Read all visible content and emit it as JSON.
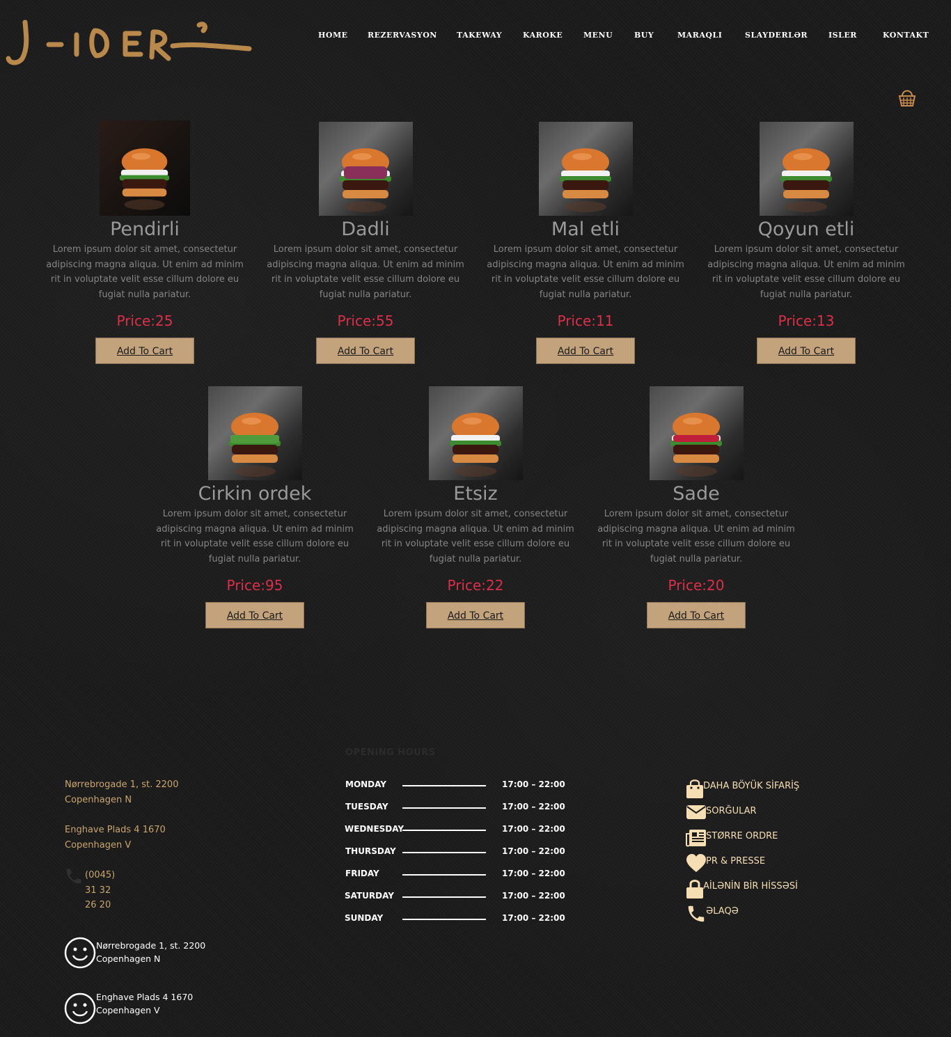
{
  "brand": {
    "logo_text": "SLIDER"
  },
  "nav": [
    "HOME",
    "REZERVASYON",
    "TAKEWAY",
    "KAROKE",
    "MENU",
    "BUY",
    "MARAQLI",
    "SLAYDERLƏR",
    "ISLER",
    "KONTAKT"
  ],
  "products": [
    {
      "name": "Pendirli",
      "desc": "Lorem ipsum dolor sit amet, consectetur adipiscing magna aliqua. Ut enim ad minim rit in voluptate velit esse cillum dolore eu fugiat nulla pariatur.",
      "price": "Price:25",
      "button": "Add To Cart"
    },
    {
      "name": "Dadli",
      "desc": "Lorem ipsum dolor sit amet, consectetur adipiscing magna aliqua. Ut enim ad minim rit in voluptate velit esse cillum dolore eu fugiat nulla pariatur.",
      "price": "Price:55",
      "button": "Add To Cart"
    },
    {
      "name": "Mal etli",
      "desc": "Lorem ipsum dolor sit amet, consectetur adipiscing magna aliqua. Ut enim ad minim rit in voluptate velit esse cillum dolore eu fugiat nulla pariatur.",
      "price": "Price:11",
      "button": "Add To Cart"
    },
    {
      "name": "Qoyun etli",
      "desc": "Lorem ipsum dolor sit amet, consectetur adipiscing magna aliqua. Ut enim ad minim rit in voluptate velit esse cillum dolore eu fugiat nulla pariatur.",
      "price": "Price:13",
      "button": "Add To Cart"
    },
    {
      "name": "Cirkin ordek",
      "desc": "Lorem ipsum dolor sit amet, consectetur adipiscing magna aliqua. Ut enim ad minim rit in voluptate velit esse cillum dolore eu fugiat nulla pariatur.",
      "price": "Price:95",
      "button": "Add To Cart"
    },
    {
      "name": "Etsiz",
      "desc": "Lorem ipsum dolor sit amet, consectetur adipiscing magna aliqua. Ut enim ad minim rit in voluptate velit esse cillum dolore eu fugiat nulla pariatur.",
      "price": "Price:22",
      "button": "Add To Cart"
    },
    {
      "name": "Sade",
      "desc": "Lorem ipsum dolor sit amet, consectetur adipiscing magna aliqua. Ut enim ad minim rit in voluptate velit esse cillum dolore eu fugiat nulla pariatur.",
      "price": "Price:20",
      "button": "Add To Cart"
    }
  ],
  "footer": {
    "address1": {
      "line1": "Nørrebrogade 1, st. 2200",
      "line2": "Copenhagen N"
    },
    "address2": {
      "line1": "Enghave Plads 4 1670",
      "line2": "Copenhagen V"
    },
    "phone": "(0045) 31 32 26 20",
    "hours_title": "OPENING HOURS",
    "hours": [
      {
        "day": "MONDAY",
        "time": "17:00 – 22:00"
      },
      {
        "day": "TUESDAY",
        "time": "17:00 – 22:00"
      },
      {
        "day": "WEDNESDAY",
        "time": "17:00 – 22:00"
      },
      {
        "day": "THURSDAY",
        "time": "17:00 – 22:00"
      },
      {
        "day": "FRIDAY",
        "time": "17:00 – 22:00"
      },
      {
        "day": "SATURDAY",
        "time": "17:00 – 22:00"
      },
      {
        "day": "SUNDAY",
        "time": "17:00 – 22:00"
      }
    ],
    "links": [
      {
        "label": "DAHA BÖYÜK SİFARİŞ",
        "icon": "bag-icon"
      },
      {
        "label": "SORĞULAR",
        "icon": "envelope-icon"
      },
      {
        "label": "STØRRE ORDRE",
        "icon": "newspaper-icon"
      },
      {
        "label": "PR & PRESSE",
        "icon": "heart-icon"
      },
      {
        "label": "AİLƏNİN BİR HİSSƏSİ",
        "icon": "lock-icon"
      },
      {
        "label": "ƏLAQƏ",
        "icon": "phone-icon"
      }
    ],
    "locations": [
      {
        "line1": "Nørrebrogade 1, st. 2200",
        "line2": "Copenhagen N",
        "icon": "smiley-icon"
      },
      {
        "line1": "Enghave Plads 4 1670",
        "line2": "Copenhagen V",
        "icon": "smiley-icon"
      }
    ]
  },
  "colors": {
    "accent": "#c2a37b",
    "price": "#dc2f48",
    "gold_text": "#c9a66e",
    "link_text": "#f5deb3"
  }
}
